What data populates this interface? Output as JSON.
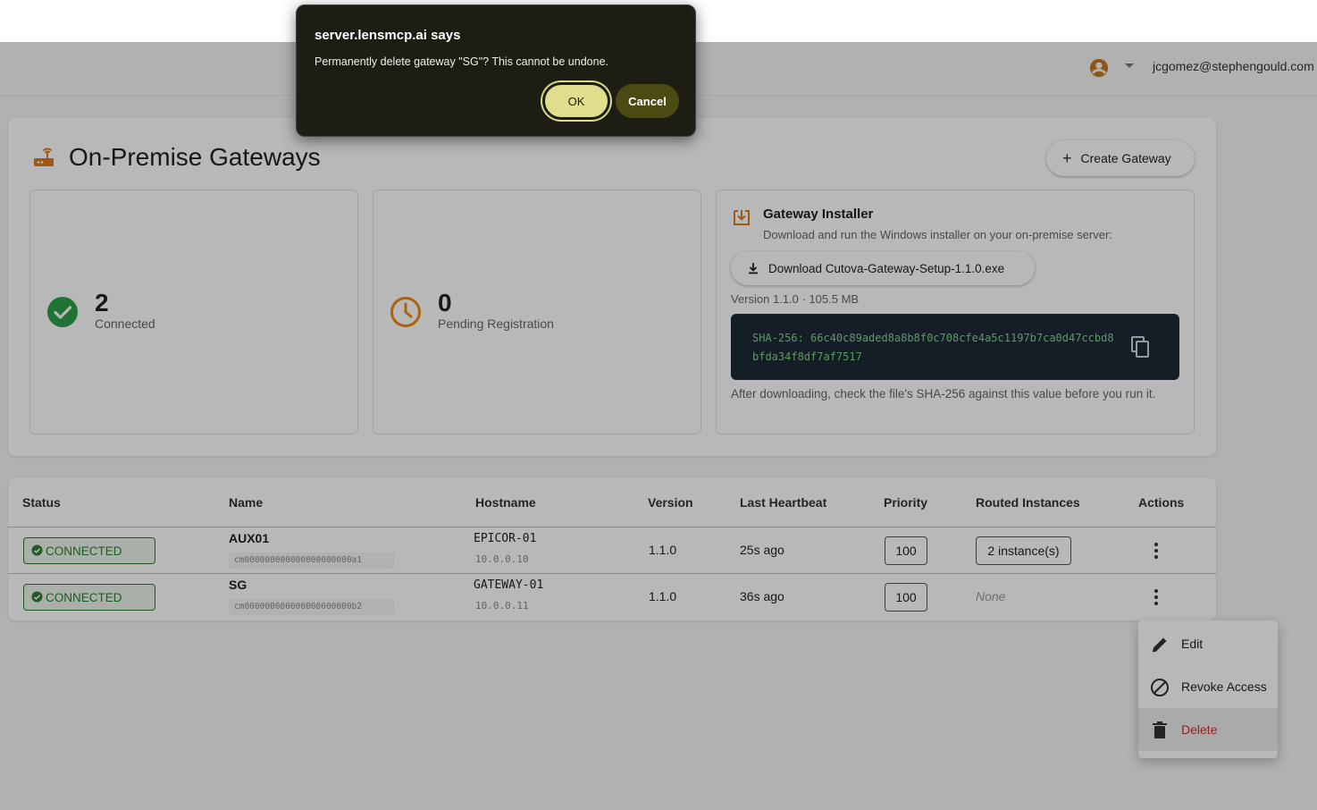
{
  "header": {
    "user_email": "jcgomez@stephengould.com"
  },
  "page": {
    "title": "On-Premise Gateways",
    "create_button_label": "Create Gateway"
  },
  "stats": {
    "connected": {
      "value": "2",
      "label": "Connected"
    },
    "pending": {
      "value": "0",
      "label": "Pending Registration"
    }
  },
  "installer": {
    "title": "Gateway Installer",
    "description": "Download and run the Windows installer on your on-premise server:",
    "download_label": "Download Cutova-Gateway-Setup-1.1.0.exe",
    "version_info": "Version 1.1.0 · 105.5 MB",
    "sha_text": "SHA-256: 66c40c89aded8a8b8f0c708cfe4a5c1197b7ca0d47ccbd8bfda34f8df7af7517",
    "note": "After downloading, check the file's SHA-256 against this value before you run it."
  },
  "table": {
    "headers": [
      "Status",
      "Name",
      "Hostname",
      "Version",
      "Last Heartbeat",
      "Priority",
      "Routed Instances",
      "Actions"
    ],
    "rows": [
      {
        "status": "CONNECTED",
        "name": "AUX01",
        "id": "cm000000000000000000000a1",
        "hostname": "EPICOR-01",
        "ip": "10.0.0.10",
        "version": "1.1.0",
        "heartbeat": "25s ago",
        "priority": "100",
        "routed": "2 instance(s)"
      },
      {
        "status": "CONNECTED",
        "name": "SG",
        "id": "cm000000000000000000000b2",
        "hostname": "GATEWAY-01",
        "ip": "10.0.0.11",
        "version": "1.1.0",
        "heartbeat": "36s ago",
        "priority": "100",
        "routed": "None"
      }
    ]
  },
  "menu": {
    "edit": "Edit",
    "revoke": "Revoke Access",
    "delete": "Delete"
  },
  "dialog": {
    "title": "server.lensmcp.ai says",
    "message": "Permanently delete gateway \"SG\"? This cannot be undone.",
    "ok_label": "OK",
    "cancel_label": "Cancel"
  },
  "colors": {
    "success": "#2e7d32",
    "pending": "#f57c00",
    "danger": "#d32f2f",
    "dialog_bg": "#1d1d14",
    "ok_button": "#dede8c"
  },
  "icons": [
    "account-circle-icon",
    "caret-down-icon",
    "router-icon",
    "plus-icon",
    "check-circle-icon",
    "clock-icon",
    "download-box-icon",
    "download-icon",
    "copy-icon",
    "kebab-icon",
    "pencil-icon",
    "block-icon",
    "trash-icon"
  ]
}
